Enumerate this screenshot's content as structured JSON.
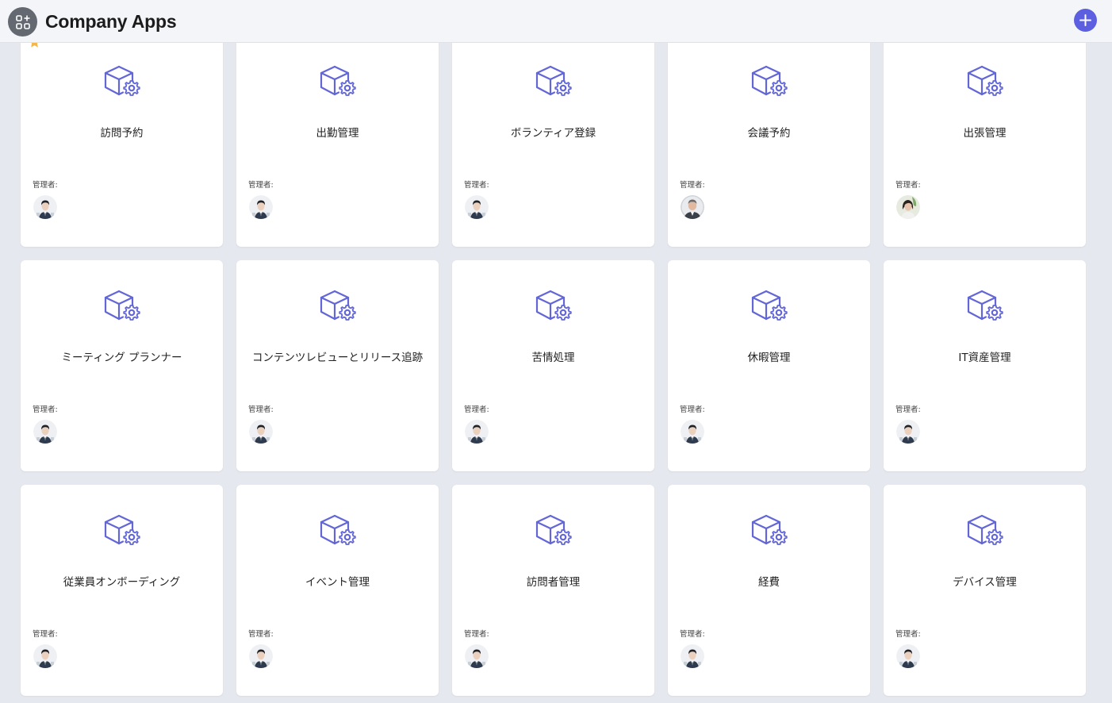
{
  "header": {
    "title": "Company Apps",
    "logo_icon": "apps-grid-icon",
    "add_icon": "plus-icon"
  },
  "colors": {
    "accent": "#5b5fe0",
    "app_icon_stroke": "#6266d6",
    "favorite_star": "#f2b64c",
    "background": "#e6e8ef",
    "card": "#ffffff"
  },
  "apps": [
    {
      "name": "訪問予約",
      "admin_label": "管理者:",
      "admin_avatar": "male-avatar-a",
      "favorite": true
    },
    {
      "name": "出勤管理",
      "admin_label": "管理者:",
      "admin_avatar": "male-avatar-a",
      "favorite": false
    },
    {
      "name": "ボランティア登録",
      "admin_label": "管理者:",
      "admin_avatar": "male-avatar-a",
      "favorite": false
    },
    {
      "name": "会議予約",
      "admin_label": "管理者:",
      "admin_avatar": "male-avatar-b",
      "favorite": false
    },
    {
      "name": "出張管理",
      "admin_label": "管理者:",
      "admin_avatar": "female-avatar",
      "favorite": false
    },
    {
      "name": "ミーティング プランナー",
      "admin_label": "管理者:",
      "admin_avatar": "male-avatar-a",
      "favorite": false
    },
    {
      "name": "コンテンツレビューとリリース追跡",
      "admin_label": "管理者:",
      "admin_avatar": "male-avatar-a",
      "favorite": false
    },
    {
      "name": "苦情処理",
      "admin_label": "管理者:",
      "admin_avatar": "male-avatar-a",
      "favorite": false
    },
    {
      "name": "休暇管理",
      "admin_label": "管理者:",
      "admin_avatar": "male-avatar-a",
      "favorite": false
    },
    {
      "name": "IT資産管理",
      "admin_label": "管理者:",
      "admin_avatar": "male-avatar-a",
      "favorite": false
    },
    {
      "name": "従業員オンボーディング",
      "admin_label": "管理者:",
      "admin_avatar": "male-avatar-a",
      "favorite": false
    },
    {
      "name": "イベント管理",
      "admin_label": "管理者:",
      "admin_avatar": "male-avatar-a",
      "favorite": false
    },
    {
      "name": "訪問者管理",
      "admin_label": "管理者:",
      "admin_avatar": "male-avatar-a",
      "favorite": false
    },
    {
      "name": "経費",
      "admin_label": "管理者:",
      "admin_avatar": "male-avatar-a",
      "favorite": false
    },
    {
      "name": "デバイス管理",
      "admin_label": "管理者:",
      "admin_avatar": "male-avatar-a",
      "favorite": false
    }
  ]
}
